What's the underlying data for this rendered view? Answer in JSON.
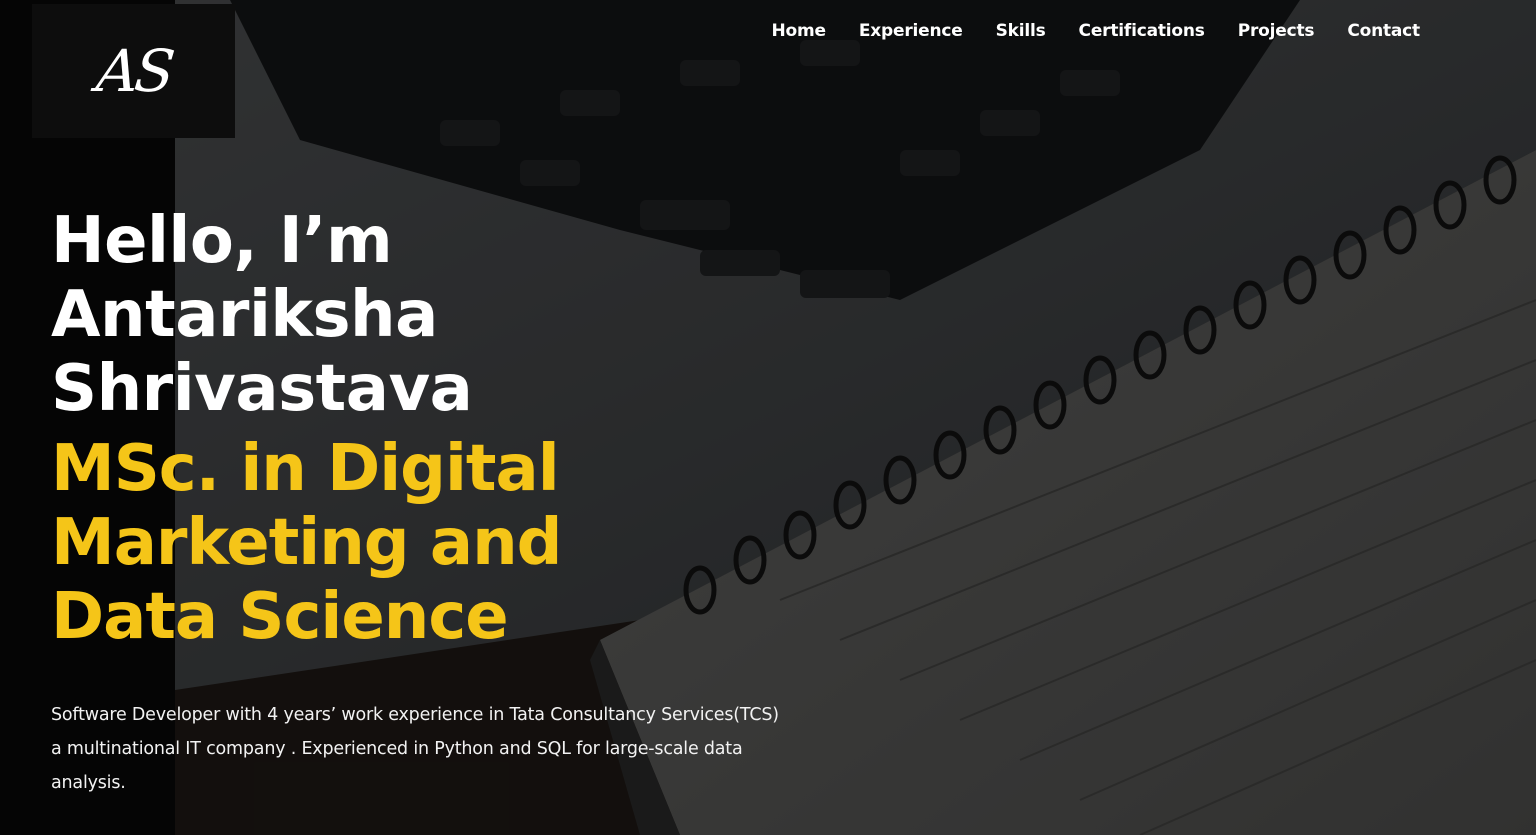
{
  "logo": {
    "text": "AS"
  },
  "nav": {
    "items": [
      "Home",
      "Experience",
      "Skills",
      "Certifications",
      "Projects",
      "Contact"
    ]
  },
  "hero": {
    "greeting_lines": [
      "Hello, I’m",
      "Antariksha",
      "Shrivastava"
    ],
    "degree_lines": [
      "MSc. in Digital",
      "Marketing and",
      "Data Science"
    ],
    "bio": "Software Developer with 4 years’ work experience in Tata Consultancy Services(TCS) a multinational IT company . Experienced in Python and SQL for large-scale data analysis."
  },
  "colors": {
    "accent": "#f5c518",
    "text": "#ffffff",
    "background": "#0b0b0b"
  }
}
